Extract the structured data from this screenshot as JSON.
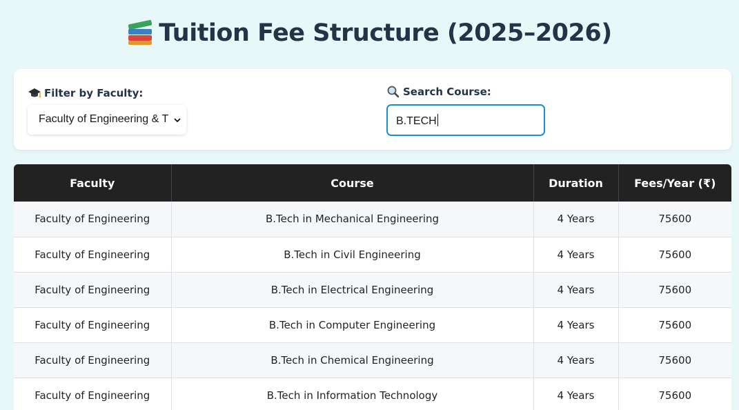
{
  "page": {
    "title": "Tuition Fee Structure (2025–2026)",
    "title_icon": "books-icon"
  },
  "filters": {
    "faculty_label": "Filter by Faculty:",
    "faculty_icon": "graduation-cap-icon",
    "faculty_selected": "Faculty of Engineering & T",
    "search_label": "Search Course:",
    "search_icon": "magnifier-icon",
    "search_value": "B.TECH"
  },
  "table": {
    "headers": [
      "Faculty",
      "Course",
      "Duration",
      "Fees/Year (₹)"
    ],
    "rows": [
      {
        "faculty": "Faculty of Engineering",
        "course": "B.Tech in Mechanical Engineering",
        "duration": "4 Years",
        "fees": "75600"
      },
      {
        "faculty": "Faculty of Engineering",
        "course": "B.Tech in Civil Engineering",
        "duration": "4 Years",
        "fees": "75600"
      },
      {
        "faculty": "Faculty of Engineering",
        "course": "B.Tech in Electrical Engineering",
        "duration": "4 Years",
        "fees": "75600"
      },
      {
        "faculty": "Faculty of Engineering",
        "course": "B.Tech in Computer Engineering",
        "duration": "4 Years",
        "fees": "75600"
      },
      {
        "faculty": "Faculty of Engineering",
        "course": "B.Tech in Chemical Engineering",
        "duration": "4 Years",
        "fees": "75600"
      },
      {
        "faculty": "Faculty of Engineering",
        "course": "B.Tech in Information Technology",
        "duration": "4 Years",
        "fees": "75600"
      }
    ]
  },
  "colors": {
    "background": "#e8f8f8",
    "header_bg": "#222222",
    "accent_border": "#1a8fd0"
  }
}
